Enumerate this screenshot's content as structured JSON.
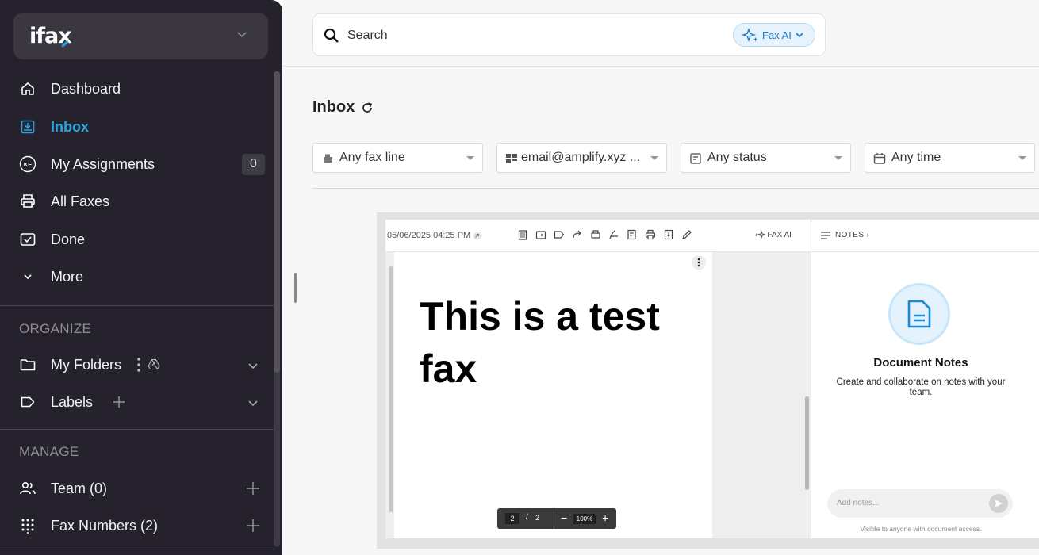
{
  "brand": {
    "logo": "ifax"
  },
  "sidebar": {
    "items": [
      {
        "label": "Dashboard",
        "icon": "home-icon"
      },
      {
        "label": "Inbox",
        "icon": "inbox-icon",
        "active": true
      },
      {
        "label": "My Assignments",
        "icon": "ke-badge-icon",
        "badge_text": "KE",
        "count": "0"
      },
      {
        "label": "All Faxes",
        "icon": "printer-icon"
      },
      {
        "label": "Done",
        "icon": "check-box-icon"
      },
      {
        "label": "More",
        "icon": "chevron-down-icon"
      }
    ],
    "organize": {
      "title": "ORGANIZE",
      "my_folders": "My Folders",
      "labels": "Labels"
    },
    "manage": {
      "title": "MANAGE",
      "team": "Team (0)",
      "fax_numbers": "Fax Numbers (2)"
    }
  },
  "search": {
    "placeholder": "Search",
    "fax_ai": "Fax AI"
  },
  "page": {
    "title": "Inbox"
  },
  "filters": [
    {
      "label": "Any fax line",
      "icon": "fax-icon"
    },
    {
      "label": "email@amplify.xyz ...",
      "icon": "grid-icon"
    },
    {
      "label": "Any status",
      "icon": "status-icon"
    },
    {
      "label": "Any time",
      "icon": "calendar-icon"
    }
  ],
  "viewer": {
    "timestamp": "05/06/2025 04:25 PM",
    "fax_ai": "FAX AI",
    "notes_tab": "NOTES",
    "document_text": "This is a test fax",
    "page_current": "2",
    "page_total": "2",
    "zoom": "100%"
  },
  "notes": {
    "title": "Document Notes",
    "description": "Create and collaborate on notes with your team.",
    "input_placeholder": "Add notes...",
    "footer": "Visible to anyone with document access."
  },
  "colors": {
    "accent": "#2aa3e0",
    "sidebar_bg": "#25222d",
    "faxai": "#1877c9"
  }
}
